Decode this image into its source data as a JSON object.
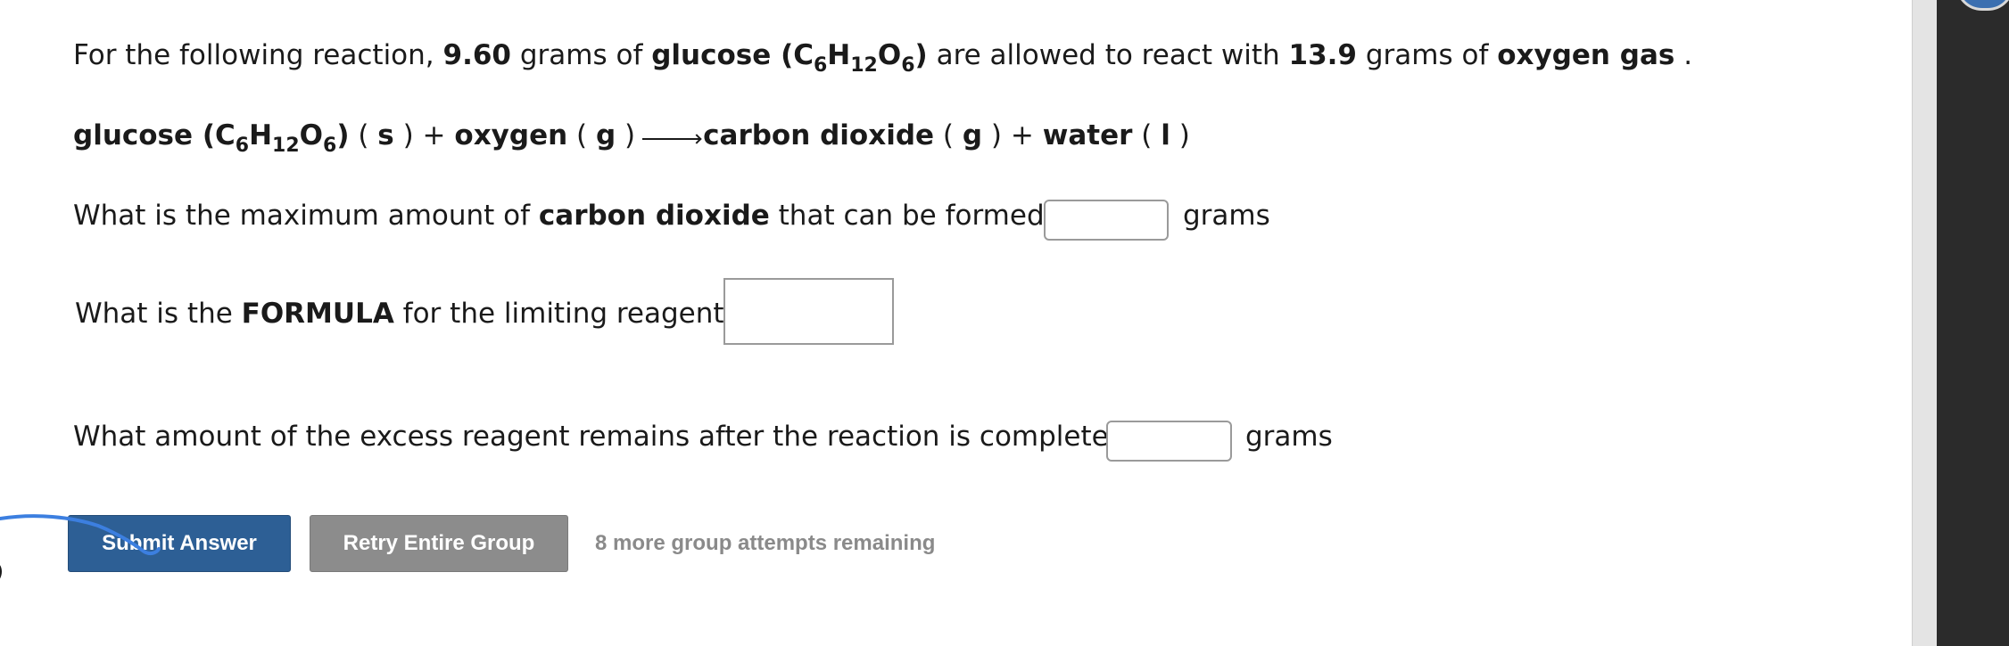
{
  "intro": {
    "prefix": "For the following reaction, ",
    "glucose_mass": "9.60",
    "mid1": " grams of ",
    "glucose_name": "glucose (C",
    "c_sub": "6",
    "h_letter": "H",
    "h_sub": "12",
    "o_letter": "O",
    "o_sub": "6",
    "close": ")",
    "mid2": " are allowed to react with ",
    "oxygen_mass": "13.9",
    "mid3": " grams of ",
    "oxygen_name": "oxygen gas",
    "end": " ."
  },
  "equation": {
    "r1_name": "glucose (C",
    "c_sub": "6",
    "h_letter": "H",
    "h_sub": "12",
    "o_letter": "O",
    "o_sub": "6",
    "r1_close": ")",
    "r1_state_open": " ( ",
    "r1_state": "s",
    "r1_state_close": " ) + ",
    "r2_name": "oxygen",
    "r2_state_open": " ( ",
    "r2_state": "g",
    "r2_state_close": " )",
    "p1_name": "carbon dioxide",
    "p1_state_open": " ( ",
    "p1_state": "g",
    "p1_state_close": " ) + ",
    "p2_name": "water",
    "p2_state_open": " ( ",
    "p2_state": "l",
    "p2_state_close": " )"
  },
  "q1": {
    "prefix": "What is the maximum amount of ",
    "bold": "carbon dioxide",
    "suffix": " that can be formed?",
    "value": "",
    "unit": "grams"
  },
  "q2": {
    "prefix": "What is the ",
    "bold": "FORMULA",
    "suffix": " for the limiting reagent?",
    "value": ""
  },
  "q3": {
    "text": "What amount of the excess reagent remains after the reaction is complete?",
    "value": "",
    "unit": "grams"
  },
  "buttons": {
    "submit": "Submit Answer",
    "retry": "Retry Entire Group"
  },
  "attempts_text": "8 more group attempts remaining",
  "colors": {
    "submit_bg": "#2d5f95",
    "retry_bg": "#8c8c8c",
    "attempts_text": "#8a8a8a",
    "pen_stroke": "#3c7fe0"
  }
}
